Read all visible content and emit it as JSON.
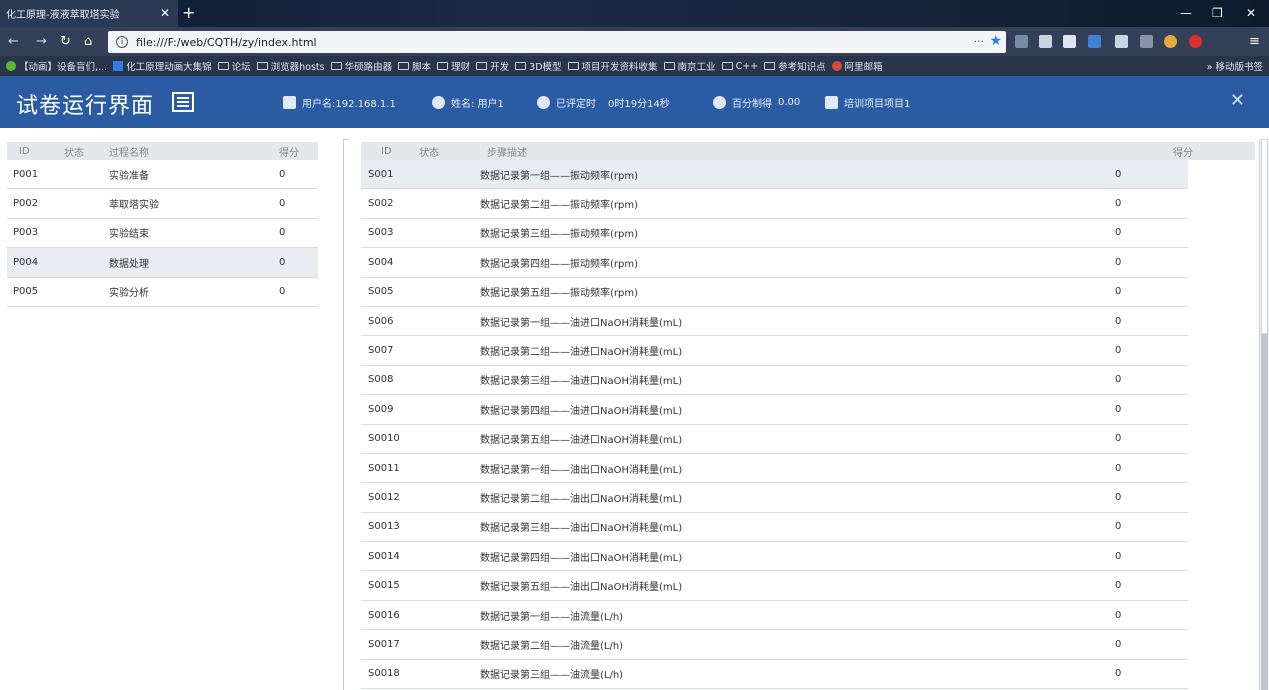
{
  "browser": {
    "tab_title": "化工原理-液液萃取塔实验",
    "tab_close": "✕",
    "new_tab": "+",
    "url": "file:///F:/web/CQTH/zy/index.html",
    "url_more": "···",
    "bookmarks": [
      "【动画】设备盲们,...",
      "化工原理动画大集锦",
      "论坛",
      "浏览器hosts",
      "华硕路由器",
      "脚本",
      "理财",
      "开发",
      "3D模型",
      "项目开发资料收集",
      "南京工业",
      "C++",
      "参考知识点",
      "阿里邮箱"
    ],
    "bookmarks_right": "移动版书签",
    "overflow": "»"
  },
  "header": {
    "title": "试卷运行界面",
    "user_label": "用户名:192.168.1.1",
    "name_label": "姓名: 用户1",
    "time_label": "已评定时",
    "time_value": "0时19分14秒",
    "score_label": "百分制得",
    "score_value": "0.00",
    "project_label": "培训项目项目1",
    "close": "✕"
  },
  "left_table": {
    "headers": [
      "ID",
      "状态",
      "过程名称",
      "得分"
    ],
    "rows": [
      {
        "id": "P001",
        "status": "green",
        "name": "实验准备",
        "score": "0"
      },
      {
        "id": "P002",
        "status": "green",
        "name": "萃取塔实验",
        "score": "0"
      },
      {
        "id": "P003",
        "status": "blue",
        "name": "实验结束",
        "score": "0"
      },
      {
        "id": "P004",
        "status": "green",
        "name": "数据处理",
        "score": "0"
      },
      {
        "id": "P005",
        "status": "green",
        "name": "实验分析",
        "score": "0"
      }
    ]
  },
  "right_table": {
    "headers": [
      "ID",
      "状态",
      "步骤描述",
      "得分"
    ],
    "rows": [
      {
        "id": "S001",
        "desc": "数据记录第一组——振动频率(rpm)",
        "score": "0"
      },
      {
        "id": "S002",
        "desc": "数据记录第二组——振动频率(rpm)",
        "score": "0"
      },
      {
        "id": "S003",
        "desc": "数据记录第三组——振动频率(rpm)",
        "score": "0"
      },
      {
        "id": "S004",
        "desc": "数据记录第四组——振动频率(rpm)",
        "score": "0"
      },
      {
        "id": "S005",
        "desc": "数据记录第五组——振动频率(rpm)",
        "score": "0"
      },
      {
        "id": "S006",
        "desc": "数据记录第一组——油进口NaOH消耗量(mL)",
        "score": "0"
      },
      {
        "id": "S007",
        "desc": "数据记录第二组——油进口NaOH消耗量(mL)",
        "score": "0"
      },
      {
        "id": "S008",
        "desc": "数据记录第三组——油进口NaOH消耗量(mL)",
        "score": "0"
      },
      {
        "id": "S009",
        "desc": "数据记录第四组——油进口NaOH消耗量(mL)",
        "score": "0"
      },
      {
        "id": "S0010",
        "desc": "数据记录第五组——油进口NaOH消耗量(mL)",
        "score": "0"
      },
      {
        "id": "S0011",
        "desc": "数据记录第一组——油出口NaOH消耗量(mL)",
        "score": "0"
      },
      {
        "id": "S0012",
        "desc": "数据记录第二组——油出口NaOH消耗量(mL)",
        "score": "0"
      },
      {
        "id": "S0013",
        "desc": "数据记录第三组——油出口NaOH消耗量(mL)",
        "score": "0"
      },
      {
        "id": "S0014",
        "desc": "数据记录第四组——油出口NaOH消耗量(mL)",
        "score": "0"
      },
      {
        "id": "S0015",
        "desc": "数据记录第五组——油出口NaOH消耗量(mL)",
        "score": "0"
      },
      {
        "id": "S0016",
        "desc": "数据记录第一组——油流量(L/h)",
        "score": "0"
      },
      {
        "id": "S0017",
        "desc": "数据记录第二组——油流量(L/h)",
        "score": "0"
      },
      {
        "id": "S0018",
        "desc": "数据记录第三组——油流量(L/h)",
        "score": "0"
      }
    ]
  }
}
